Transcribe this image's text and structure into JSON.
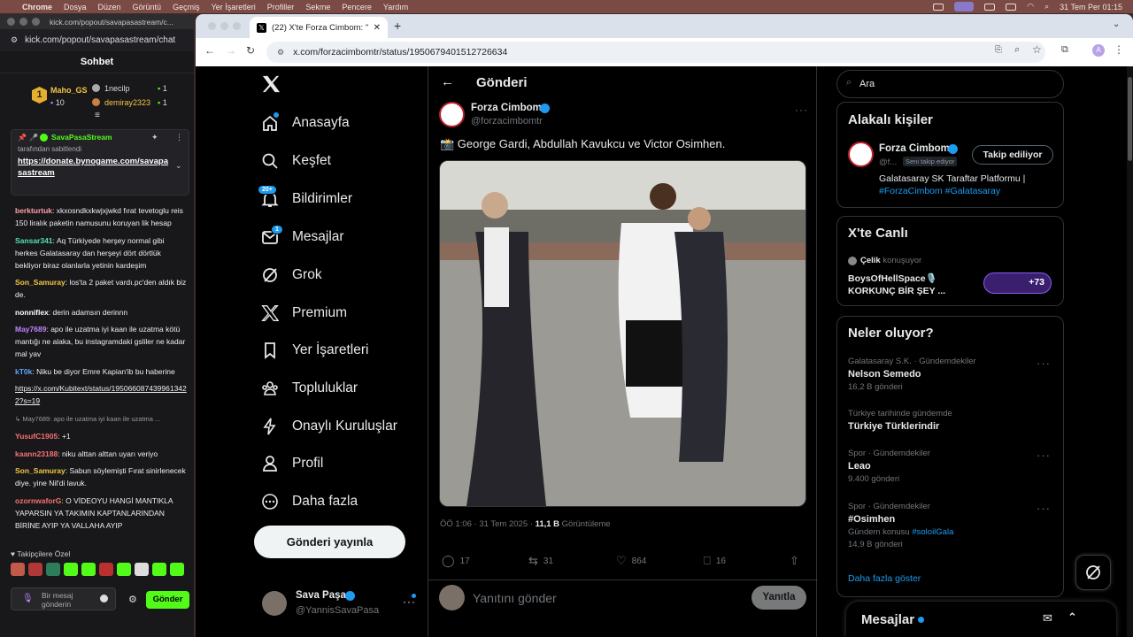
{
  "menubar": {
    "items": [
      "Chrome",
      "Dosya",
      "Düzen",
      "Görüntü",
      "Geçmiş",
      "Yer İşaretleri",
      "Profiller",
      "Sekme",
      "Pencere",
      "Yardım"
    ],
    "clock": "31 Tem Per  01:15"
  },
  "chat_window": {
    "title": "kick.com/popout/savapasastream/c...",
    "url": "kick.com/popout/savapasastream/chat",
    "header": "Sohbet",
    "leaderboard": {
      "rank1_name": "Maho_GS",
      "rank1_value": "10",
      "rank2_name": "1necilp",
      "rank2_value": "1",
      "rank3_name": "demiray2323",
      "rank3_value": "1"
    },
    "pinned": {
      "author": "SavaPasaStream",
      "note": "tarafından sabitlendi",
      "link": "https://donate.bynogame.com/savapasastream"
    },
    "messages": [
      {
        "user": "berkturtuk",
        "color": "#ff9ea8",
        "text": "xkxosndkxkwjxjwkd fırat tevetoglu reis 150 liralık paketin namusunu koruyan lik hesap"
      },
      {
        "user": "Sansar341",
        "color": "#54e0b0",
        "text": "Aq Türkiyede herşey normal gibi herkes Galatasaray dan herşeyi dört dörtlük bekliyor biraz olanlarla yetinin kardeşim"
      },
      {
        "user": "Son_Samuray",
        "color": "#f5c542",
        "text": "los'ta 2 paket vardı.pc'den aldık biz de."
      },
      {
        "user": "nonniflex",
        "color": "#ffffff",
        "text": "derin adamsın derinnn"
      },
      {
        "user": "May7689",
        "color": "#c084fc",
        "text": "apo ile uzatma iyi kaan ile uzatma kötü mantığı ne alaka, bu instagramdaki gsliler ne kadar mal yav"
      },
      {
        "user": "kT0k",
        "color": "#60a5fa",
        "text": "Niku be diyor Emre Kapian'ib bu haberine"
      },
      {
        "user": "",
        "color": "#ffffff",
        "text": "https://x.com/Kubitext/status/1950660874399613422?s=19"
      },
      {
        "user": "",
        "color": "#9a9a9a",
        "text": "↳ May7689: apo ile uzatma iyi kaan ile uzatma ..."
      },
      {
        "user": "YusufC1905",
        "color": "#f87171",
        "text": "+1"
      },
      {
        "user": "kaann23188",
        "color": "#f87171",
        "text": "niku alttan alttan uyarı veriyo"
      },
      {
        "user": "Son_Samuray",
        "color": "#f5c542",
        "text": "Sabun söylemişti Fırat sinirlenecek diye. yine Nil'di lavuk."
      },
      {
        "user": "ozornwaforG",
        "color": "#f87171",
        "text": "O VİDEOYU HANGİ MANTIKLA YAPARSIN YA TAKIMIN KAPTANLARINDAN BİRİNE AYIP YA VALLAHA AYIP"
      }
    ],
    "followers_label": "Takipçilere Özel",
    "input_placeholder": "Bir mesaj gönderin",
    "send_label": "Gönder"
  },
  "browser": {
    "tab_title": "(22) X'te Forza Cimbom: \"📸...",
    "url": "x.com/forzacimbomtr/status/1950679401512726634"
  },
  "x_nav": {
    "items": [
      "Anasayfa",
      "Keşfet",
      "Bildirimler",
      "Mesajlar",
      "Grok",
      "Premium",
      "Yer İşaretleri",
      "Topluluklar",
      "Onaylı Kuruluşlar",
      "Profil",
      "Daha fazla"
    ],
    "notif_badge": "20+",
    "msg_badge": "1",
    "post_button": "Gönderi yayınla",
    "account_name": "Sava Paşa",
    "account_handle": "@YannisSavaPasa"
  },
  "post": {
    "header": "Gönderi",
    "author": "Forza Cimbom",
    "handle": "@forzacimbomtr",
    "text": "📸 George Gardi, Abdullah Kavukcu ve Victor Osimhen.",
    "timestamp": "ÖÖ 1:06 · 31 Tem 2025 · ",
    "views_count": "11,1 B",
    "views_label": " Görüntüleme",
    "replies": "17",
    "reposts": "31",
    "likes": "864",
    "bookmarks": "16",
    "reply_placeholder": "Yanıtını gönder",
    "reply_button": "Yanıtla"
  },
  "sidebar": {
    "search_placeholder": "Ara",
    "related_title": "Alakalı kişiler",
    "related_name": "Forza Cimbom",
    "related_handle": "@f...",
    "follows_you": "Seni takip ediyor",
    "following_btn": "Takip ediliyor",
    "related_bio": "Galatasaray SK Taraftar Platformu | ",
    "related_tags": "#ForzaCimbom #Galatasaray",
    "live_title": "X'te Canlı",
    "live_host": "Çelik",
    "live_host_suffix": " konuşuyor",
    "live_space": "BoysOfHellSpace🎙️ KORKUNÇ BİR ŞEY ...",
    "live_count": "+73",
    "trends_title": "Neler oluyor?",
    "trends": [
      {
        "context": "Galatasaray S.K. · Gündemdekiler",
        "name": "Nelson Semedo",
        "meta": "16,2 B gönderi"
      },
      {
        "context": "Türkiye tarihinde gündemde",
        "name": "Türkiye Türklerindir",
        "meta": ""
      },
      {
        "context": "Spor · Gündemdekiler",
        "name": "Leao",
        "meta": "9.400 gönderi"
      },
      {
        "context": "Spor · Gündemdekiler",
        "name": "#Osimhen",
        "meta": "14,9 B gönderi",
        "extra": "Gündem konusu ",
        "extra_tag": "#soloilGala"
      }
    ],
    "show_more": "Daha fazla göster",
    "messages_label": "Mesajlar"
  },
  "colors": {
    "x_blue": "#1d9bf0",
    "kick_green": "#53fc18",
    "chat_bg": "#18181b"
  }
}
